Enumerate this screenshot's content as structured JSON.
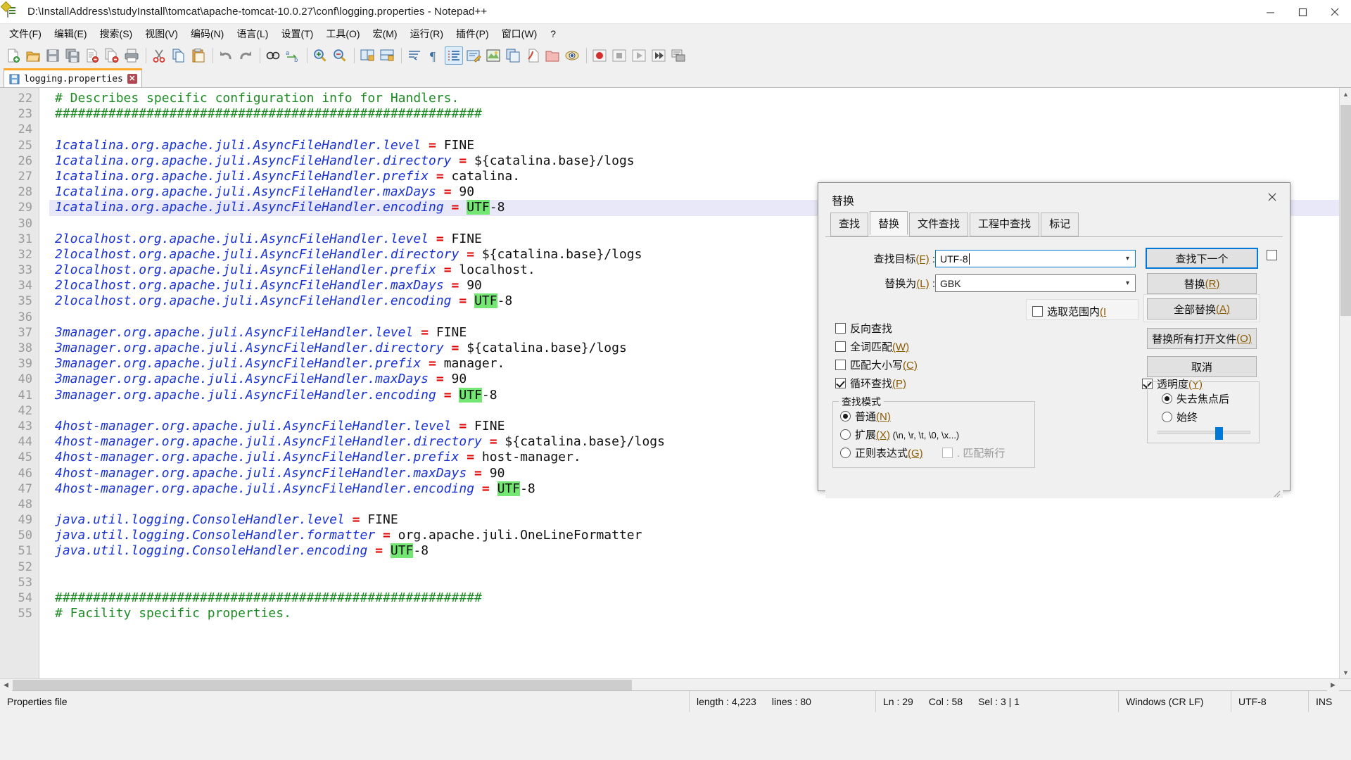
{
  "titlebar": {
    "title": "D:\\InstallAddress\\studyInstall\\tomcat\\apache-tomcat-10.0.27\\conf\\logging.properties - Notepad++",
    "minimize": "—",
    "maximize": "❐",
    "close": "✕"
  },
  "menu": {
    "items": [
      "文件(F)",
      "编辑(E)",
      "搜索(S)",
      "视图(V)",
      "编码(N)",
      "语言(L)",
      "设置(T)",
      "工具(O)",
      "宏(M)",
      "运行(R)",
      "插件(P)",
      "窗口(W)",
      "?"
    ]
  },
  "toolbar": {
    "icons": [
      "new-file-icon",
      "open-file-icon",
      "save-icon",
      "save-all-icon",
      "close-file-icon",
      "close-all-icon",
      "print-icon",
      "cut-icon",
      "copy-icon",
      "paste-icon",
      "undo-icon",
      "redo-icon",
      "find-icon",
      "replace-icon",
      "zoom-in-icon",
      "zoom-out-icon",
      "sync-vertical-icon",
      "sync-horizontal-icon",
      "word-wrap-icon",
      "show-all-chars-icon",
      "indent-guide-icon",
      "user-defined-language-icon",
      "document-map-icon",
      "document-list-icon",
      "function-list-icon",
      "folder-as-workspace-icon",
      "monitoring-icon",
      "record-macro-icon",
      "stop-macro-icon",
      "play-macro-icon",
      "play-multiple-macro-icon",
      "save-macro-icon"
    ]
  },
  "tab": {
    "name": "logging.properties",
    "close_label": "✕",
    "icon": "save-diskette-icon"
  },
  "editor": {
    "first_line": 22,
    "current_line": 29,
    "lines": [
      {
        "n": 22,
        "segs": [
          {
            "t": "# Describes specific configuration info for Handlers.",
            "c": "c"
          }
        ]
      },
      {
        "n": 23,
        "segs": [
          {
            "t": "########################################################",
            "c": "c"
          }
        ]
      },
      {
        "n": 24,
        "segs": []
      },
      {
        "n": 25,
        "segs": [
          {
            "t": "1catalina.org.apache.juli.AsyncFileHandler.level",
            "c": "k"
          },
          {
            "t": " ",
            "c": "v"
          },
          {
            "t": "=",
            "c": "eq"
          },
          {
            "t": " FINE",
            "c": "v"
          }
        ]
      },
      {
        "n": 26,
        "segs": [
          {
            "t": "1catalina.org.apache.juli.AsyncFileHandler.directory",
            "c": "k"
          },
          {
            "t": " ",
            "c": "v"
          },
          {
            "t": "=",
            "c": "eq"
          },
          {
            "t": " ${catalina.base}/logs",
            "c": "v"
          }
        ]
      },
      {
        "n": 27,
        "segs": [
          {
            "t": "1catalina.org.apache.juli.AsyncFileHandler.prefix",
            "c": "k"
          },
          {
            "t": " ",
            "c": "v"
          },
          {
            "t": "=",
            "c": "eq"
          },
          {
            "t": " catalina.",
            "c": "v"
          }
        ]
      },
      {
        "n": 28,
        "segs": [
          {
            "t": "1catalina.org.apache.juli.AsyncFileHandler.maxDays",
            "c": "k"
          },
          {
            "t": " ",
            "c": "v"
          },
          {
            "t": "=",
            "c": "eq"
          },
          {
            "t": " 90",
            "c": "v"
          }
        ]
      },
      {
        "n": 29,
        "segs": [
          {
            "t": "1catalina.org.apache.juli.AsyncFileHandler.encoding",
            "c": "k"
          },
          {
            "t": " ",
            "c": "v"
          },
          {
            "t": "=",
            "c": "eq"
          },
          {
            "t": " ",
            "c": "v"
          },
          {
            "t": "UTF",
            "c": "hl"
          },
          {
            "t": "-8",
            "c": "v"
          }
        ],
        "current": true
      },
      {
        "n": 30,
        "segs": []
      },
      {
        "n": 31,
        "segs": [
          {
            "t": "2localhost.org.apache.juli.AsyncFileHandler.level",
            "c": "k"
          },
          {
            "t": " ",
            "c": "v"
          },
          {
            "t": "=",
            "c": "eq"
          },
          {
            "t": " FINE",
            "c": "v"
          }
        ]
      },
      {
        "n": 32,
        "segs": [
          {
            "t": "2localhost.org.apache.juli.AsyncFileHandler.directory",
            "c": "k"
          },
          {
            "t": " ",
            "c": "v"
          },
          {
            "t": "=",
            "c": "eq"
          },
          {
            "t": " ${catalina.base}/logs",
            "c": "v"
          }
        ]
      },
      {
        "n": 33,
        "segs": [
          {
            "t": "2localhost.org.apache.juli.AsyncFileHandler.prefix",
            "c": "k"
          },
          {
            "t": " ",
            "c": "v"
          },
          {
            "t": "=",
            "c": "eq"
          },
          {
            "t": " localhost.",
            "c": "v"
          }
        ]
      },
      {
        "n": 34,
        "segs": [
          {
            "t": "2localhost.org.apache.juli.AsyncFileHandler.maxDays",
            "c": "k"
          },
          {
            "t": " ",
            "c": "v"
          },
          {
            "t": "=",
            "c": "eq"
          },
          {
            "t": " 90",
            "c": "v"
          }
        ]
      },
      {
        "n": 35,
        "segs": [
          {
            "t": "2localhost.org.apache.juli.AsyncFileHandler.encoding",
            "c": "k"
          },
          {
            "t": " ",
            "c": "v"
          },
          {
            "t": "=",
            "c": "eq"
          },
          {
            "t": " ",
            "c": "v"
          },
          {
            "t": "UTF",
            "c": "hl"
          },
          {
            "t": "-8",
            "c": "v"
          }
        ]
      },
      {
        "n": 36,
        "segs": []
      },
      {
        "n": 37,
        "segs": [
          {
            "t": "3manager.org.apache.juli.AsyncFileHandler.level",
            "c": "k"
          },
          {
            "t": " ",
            "c": "v"
          },
          {
            "t": "=",
            "c": "eq"
          },
          {
            "t": " FINE",
            "c": "v"
          }
        ]
      },
      {
        "n": 38,
        "segs": [
          {
            "t": "3manager.org.apache.juli.AsyncFileHandler.directory",
            "c": "k"
          },
          {
            "t": " ",
            "c": "v"
          },
          {
            "t": "=",
            "c": "eq"
          },
          {
            "t": " ${catalina.base}/logs",
            "c": "v"
          }
        ]
      },
      {
        "n": 39,
        "segs": [
          {
            "t": "3manager.org.apache.juli.AsyncFileHandler.prefix",
            "c": "k"
          },
          {
            "t": " ",
            "c": "v"
          },
          {
            "t": "=",
            "c": "eq"
          },
          {
            "t": " manager.",
            "c": "v"
          }
        ]
      },
      {
        "n": 40,
        "segs": [
          {
            "t": "3manager.org.apache.juli.AsyncFileHandler.maxDays",
            "c": "k"
          },
          {
            "t": " ",
            "c": "v"
          },
          {
            "t": "=",
            "c": "eq"
          },
          {
            "t": " 90",
            "c": "v"
          }
        ]
      },
      {
        "n": 41,
        "segs": [
          {
            "t": "3manager.org.apache.juli.AsyncFileHandler.encoding",
            "c": "k"
          },
          {
            "t": " ",
            "c": "v"
          },
          {
            "t": "=",
            "c": "eq"
          },
          {
            "t": " ",
            "c": "v"
          },
          {
            "t": "UTF",
            "c": "hl"
          },
          {
            "t": "-8",
            "c": "v"
          }
        ]
      },
      {
        "n": 42,
        "segs": []
      },
      {
        "n": 43,
        "segs": [
          {
            "t": "4host-manager.org.apache.juli.AsyncFileHandler.level",
            "c": "k"
          },
          {
            "t": " ",
            "c": "v"
          },
          {
            "t": "=",
            "c": "eq"
          },
          {
            "t": " FINE",
            "c": "v"
          }
        ]
      },
      {
        "n": 44,
        "segs": [
          {
            "t": "4host-manager.org.apache.juli.AsyncFileHandler.directory",
            "c": "k"
          },
          {
            "t": " ",
            "c": "v"
          },
          {
            "t": "=",
            "c": "eq"
          },
          {
            "t": " ${catalina.base}/logs",
            "c": "v"
          }
        ]
      },
      {
        "n": 45,
        "segs": [
          {
            "t": "4host-manager.org.apache.juli.AsyncFileHandler.prefix",
            "c": "k"
          },
          {
            "t": " ",
            "c": "v"
          },
          {
            "t": "=",
            "c": "eq"
          },
          {
            "t": " host-manager.",
            "c": "v"
          }
        ]
      },
      {
        "n": 46,
        "segs": [
          {
            "t": "4host-manager.org.apache.juli.AsyncFileHandler.maxDays",
            "c": "k"
          },
          {
            "t": " ",
            "c": "v"
          },
          {
            "t": "=",
            "c": "eq"
          },
          {
            "t": " 90",
            "c": "v"
          }
        ]
      },
      {
        "n": 47,
        "segs": [
          {
            "t": "4host-manager.org.apache.juli.AsyncFileHandler.encoding",
            "c": "k"
          },
          {
            "t": " ",
            "c": "v"
          },
          {
            "t": "=",
            "c": "eq"
          },
          {
            "t": " ",
            "c": "v"
          },
          {
            "t": "UTF",
            "c": "hl"
          },
          {
            "t": "-8",
            "c": "v"
          }
        ]
      },
      {
        "n": 48,
        "segs": []
      },
      {
        "n": 49,
        "segs": [
          {
            "t": "java.util.logging.ConsoleHandler.level",
            "c": "k"
          },
          {
            "t": " ",
            "c": "v"
          },
          {
            "t": "=",
            "c": "eq"
          },
          {
            "t": " FINE",
            "c": "v"
          }
        ]
      },
      {
        "n": 50,
        "segs": [
          {
            "t": "java.util.logging.ConsoleHandler.formatter",
            "c": "k"
          },
          {
            "t": " ",
            "c": "v"
          },
          {
            "t": "=",
            "c": "eq"
          },
          {
            "t": " org.apache.juli.OneLineFormatter",
            "c": "v"
          }
        ]
      },
      {
        "n": 51,
        "segs": [
          {
            "t": "java.util.logging.ConsoleHandler.encoding",
            "c": "k"
          },
          {
            "t": " ",
            "c": "v"
          },
          {
            "t": "=",
            "c": "eq"
          },
          {
            "t": " ",
            "c": "v"
          },
          {
            "t": "UTF",
            "c": "hl"
          },
          {
            "t": "-8",
            "c": "v"
          }
        ]
      },
      {
        "n": 52,
        "segs": []
      },
      {
        "n": 53,
        "segs": []
      },
      {
        "n": 54,
        "segs": [
          {
            "t": "########################################################",
            "c": "c"
          }
        ]
      },
      {
        "n": 55,
        "segs": [
          {
            "t": "# Facility specific properties.",
            "c": "c"
          }
        ]
      }
    ]
  },
  "dialog": {
    "title": "替换",
    "close_label": "✕",
    "tabs": [
      {
        "label": "查找",
        "selected": false
      },
      {
        "label": "替换",
        "selected": true
      },
      {
        "label": "文件查找",
        "selected": false
      },
      {
        "label": "工程中查找",
        "selected": false
      },
      {
        "label": "标记",
        "selected": false
      }
    ],
    "find": {
      "label": "查找目标",
      "accel": "(F)",
      "colon": " : ",
      "value": "UTF-8"
    },
    "replace": {
      "label": "替换为",
      "accel": "(L)",
      "colon": " : ",
      "value": "GBK"
    },
    "buttons": {
      "find_next": "查找下一个",
      "replace": "替换",
      "replace_accel": "(R)",
      "replace_all": "全部替换",
      "replace_all_accel": "(A)",
      "replace_all_open": "替换所有打开文件",
      "replace_all_open_accel": "(O)",
      "cancel": "取消"
    },
    "in_selection": {
      "label": "选取范围内",
      "accel": "(I",
      "checked": false
    },
    "options": [
      {
        "label": "反向查找",
        "accel": "",
        "checked": false
      },
      {
        "label": "全词匹配",
        "accel": "(W)",
        "checked": false
      },
      {
        "label": "匹配大小写",
        "accel": "(C)",
        "checked": false
      },
      {
        "label": "循环查找",
        "accel": "(P)",
        "checked": true
      }
    ],
    "search_mode": {
      "title": "查找模式",
      "items": [
        {
          "label": "普通",
          "accel": "(N)",
          "extra": "",
          "selected": true
        },
        {
          "label": "扩展",
          "accel": "(X)",
          "extra": " (\\n, \\r, \\t, \\0, \\x...)",
          "selected": false
        },
        {
          "label": "正则表达式",
          "accel": "(G)",
          "extra": "",
          "selected": false
        }
      ],
      "dot_matches_newline": {
        "label": ". 匹配新行",
        "checked": false
      }
    },
    "transparency": {
      "label": "透明度",
      "accel": "(Y)",
      "checked": true,
      "modes": [
        {
          "label": "失去焦点后",
          "selected": true
        },
        {
          "label": "始终",
          "selected": false
        }
      ],
      "slider_value": 62
    }
  },
  "statusbar": {
    "doc_type": "Properties file",
    "length_label": "length : 4,223",
    "lines_label": "lines : 80",
    "ln": "Ln : 29",
    "col": "Col : 58",
    "sel": "Sel : 3 | 1",
    "eol": "Windows (CR LF)",
    "encoding": "UTF-8",
    "insert_mode": "INS"
  }
}
